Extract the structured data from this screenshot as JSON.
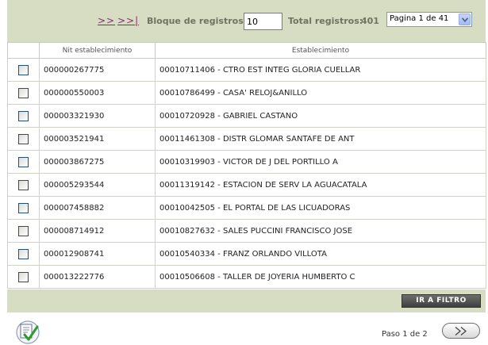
{
  "toolbar": {
    "next_label": ">>",
    "last_label": ">>|",
    "block_label": "Bloque de registros:",
    "block_value": "10",
    "total_label": "Total registros:",
    "total_value": "401",
    "page_selected": "Pagina 1 de 41"
  },
  "table": {
    "columns": [
      "",
      "Nit establecimiento",
      "Establecimiento"
    ],
    "rows": [
      {
        "nit": "000000267775",
        "establecimiento": "00010711406 - CTRO EST INTEG GLORIA CUELLAR"
      },
      {
        "nit": "000000550003",
        "establecimiento": "00010786499 - CASA' RELOJ&ANILLO"
      },
      {
        "nit": "000003321930",
        "establecimiento": "00010720928 - GABRIEL CASTANO"
      },
      {
        "nit": "000003521941",
        "establecimiento": "00011461308 - DISTR GLOMAR SANTAFE DE ANT"
      },
      {
        "nit": "000003867275",
        "establecimiento": "00010319903 - VICTOR DE J DEL PORTILLO A"
      },
      {
        "nit": "000005293544",
        "establecimiento": "00011319142 - ESTACION DE SERV LA AGUACATALA"
      },
      {
        "nit": "000007458882",
        "establecimiento": "00010042505 - EL PORTAL DE LAS LICUADORAS"
      },
      {
        "nit": "000008714912",
        "establecimiento": "00010827632 - SALES PUCCINI FRANCISCO JOSE"
      },
      {
        "nit": "000012908741",
        "establecimiento": "00010540334 - FRANZ ORLANDO VILLOTA"
      },
      {
        "nit": "000013222776",
        "establecimiento": "00010506608 - TALLER DE JOYERIA HUMBERTO C"
      }
    ]
  },
  "footer": {
    "filter_button": "IR A FILTRO",
    "step_text": "Paso 1 de 2"
  },
  "colors": {
    "toolbar_bg": "#d7ddc2",
    "link": "#8a2a70",
    "label": "#6e7461",
    "button_dark": "#4a4a4a"
  },
  "icons": [
    "checklist-icon",
    "double-chevron-right-icon",
    "chevron-down-icon"
  ]
}
